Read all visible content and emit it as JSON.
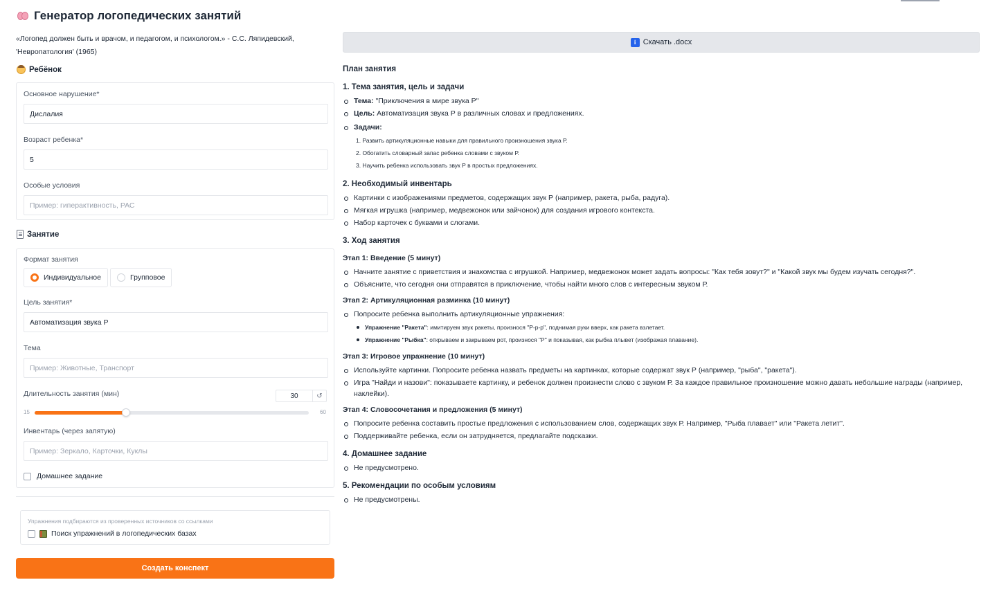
{
  "app": {
    "title": "Генератор логопедических занятий",
    "quote": "«Логопед должен быть и врачом, и педагогом, и психологом.» - С.С. Ляпидевский, 'Невропатология' (1965)"
  },
  "child_section": {
    "title": "Ребёнок",
    "disorder_label": "Основное нарушение*",
    "disorder_value": "Дислалия",
    "age_label": "Возраст ребенка*",
    "age_value": "5",
    "conditions_label": "Особые условия",
    "conditions_placeholder": "Пример: гиперактивность, РАС"
  },
  "session_section": {
    "title": "Занятие",
    "format_label": "Формат занятия",
    "format_options": [
      "Индивидуальное",
      "Групповое"
    ],
    "format_selected": "Индивидуальное",
    "goal_label": "Цель занятия*",
    "goal_value": "Автоматизация звука Р",
    "topic_label": "Тема",
    "topic_placeholder": "Пример: Животные, Транспорт",
    "duration_label": "Длительность занятия (мин)",
    "duration_value": "30",
    "duration_min": "15",
    "duration_max": "60",
    "duration_fraction": 0.3333,
    "inventory_label": "Инвентарь (через запятую)",
    "inventory_placeholder": "Пример: Зеркало, Карточки, Куклы",
    "homework_label": "Домашнее задание",
    "homework_checked": false
  },
  "search_section": {
    "hint": "Упражнения подбираются из проверенных источников со ссылками",
    "checkbox_label": "Поиск упражнений в логопедических базах",
    "checked": false
  },
  "actions": {
    "create_label": "Создать конспект",
    "download_label": "Скачать .docx"
  },
  "plan": {
    "title": "План занятия",
    "s1": {
      "heading": "1. Тема занятия, цель и задачи",
      "theme_key": "Тема:",
      "theme_val": " \"Приключения в мире звука Р\"",
      "goal_key": "Цель:",
      "goal_val": " Автоматизация звука Р в различных словах и предложениях.",
      "tasks_key": "Задачи:",
      "tasks": [
        "1. Развить артикуляционные навыки для правильного произношения звука Р.",
        "2. Обогатить словарный запас ребенка словами с звуком Р.",
        "3. Научить ребенка использовать звук Р в простых предложениях."
      ]
    },
    "s2": {
      "heading": "2. Необходимый инвентарь",
      "items": [
        "Картинки с изображениями предметов, содержащих звук Р (например, ракета, рыба, радуга).",
        "Мягкая игрушка (например, медвежонок или зайчонок) для создания игрового контекста.",
        "Набор карточек с буквами и слогами."
      ]
    },
    "s3": {
      "heading": "3. Ход занятия",
      "stage1": {
        "title": "Этап 1: Введение (5 минут)",
        "items": [
          "Начните занятие с приветствия и знакомства с игрушкой. Например, медвежонок может задать вопросы: \"Как тебя зовут?\" и \"Какой звук мы будем изучать сегодня?\".",
          "Объясните, что сегодня они отправятся в приключение, чтобы найти много слов с интересным звуком Р."
        ]
      },
      "stage2": {
        "title": "Этап 2: Артикуляционная разминка (10 минут)",
        "item": "Попросите ребенка выполнить артикуляционные упражнения:",
        "ex1_key": "Упражнение \"Ракета\"",
        "ex1_val": ": имитируем звук ракеты, произнося \"Р-р-р\", поднимая руки вверх, как ракета взлетает.",
        "ex2_key": "Упражнение \"Рыбка\"",
        "ex2_val": ": открываем и закрываем рот, произнося \"Р\" и показывая, как рыбка плывет (изображая плавание)."
      },
      "stage3": {
        "title": "Этап 3: Игровое упражнение (10 минут)",
        "items": [
          "Используйте картинки. Попросите ребенка назвать предметы на картинках, которые содержат звук Р (например, \"рыба\", \"ракета\").",
          "Игра \"Найди и назови\": показываете картинку, и ребенок должен произнести слово с звуком Р. За каждое правильное произношение можно давать небольшие награды (например, наклейки)."
        ]
      },
      "stage4": {
        "title": "Этап 4: Словосочетания и предложения (5 минут)",
        "items": [
          "Попросите ребенка составить простые предложения с использованием слов, содержащих звук Р. Например, \"Рыба плавает\" или \"Ракета летит\".",
          "Поддерживайте ребенка, если он затрудняется, предлагайте подсказки."
        ]
      }
    },
    "s4": {
      "heading": "4. Домашнее задание",
      "item": "Не предусмотрено."
    },
    "s5": {
      "heading": "5. Рекомендации по особым условиям",
      "item": "Не предусмотрены."
    }
  },
  "colors": {
    "accent": "#f97316",
    "info": "#2563eb",
    "panel_border": "#e5e7eb"
  },
  "icons": [
    "brain-icon",
    "child-icon",
    "document-icon",
    "info-icon",
    "reset-icon",
    "books-icon"
  ]
}
